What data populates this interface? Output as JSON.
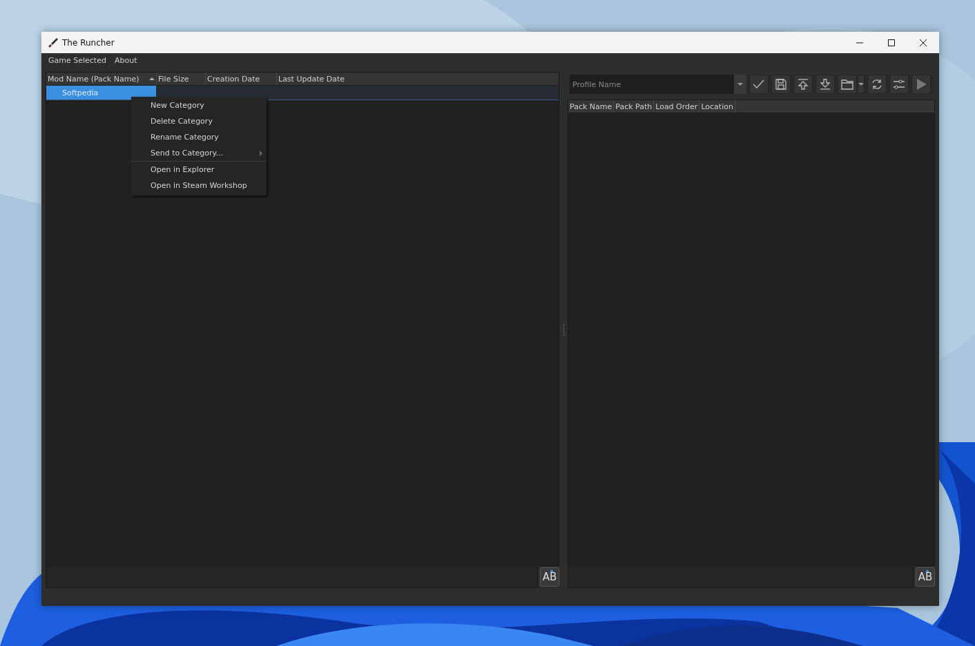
{
  "window": {
    "title": "The Runcher"
  },
  "menu": [
    {
      "label": "Game Selected"
    },
    {
      "label": "About"
    }
  ],
  "mods_table": {
    "columns": [
      {
        "label": "Mod Name (Pack Name)",
        "sorted": true
      },
      {
        "label": "File Size",
        "sorted": false
      },
      {
        "label": "Creation Date",
        "sorted": false
      },
      {
        "label": "Last Update Date",
        "sorted": false
      }
    ],
    "rows": [
      {
        "name": "Softpedia",
        "selected": true
      }
    ]
  },
  "context_menu": {
    "items": [
      {
        "label": "New Category",
        "separator_before": false,
        "has_submenu": false
      },
      {
        "label": "Delete Category",
        "separator_before": false,
        "has_submenu": false
      },
      {
        "label": "Rename Category",
        "separator_before": false,
        "has_submenu": false
      },
      {
        "label": "Send to Category...",
        "separator_before": false,
        "has_submenu": true
      },
      {
        "label": "Open in Explorer",
        "separator_before": true,
        "has_submenu": false
      },
      {
        "label": "Open in Steam Workshop",
        "separator_before": false,
        "has_submenu": false
      }
    ]
  },
  "profile": {
    "placeholder": "Profile Name"
  },
  "load_order_table": {
    "columns": [
      {
        "label": "Pack Name"
      },
      {
        "label": "Pack Path"
      },
      {
        "label": "Load Order"
      },
      {
        "label": "Location"
      }
    ]
  },
  "filters": [
    {
      "button": "AB"
    },
    {
      "button": "AB"
    }
  ]
}
